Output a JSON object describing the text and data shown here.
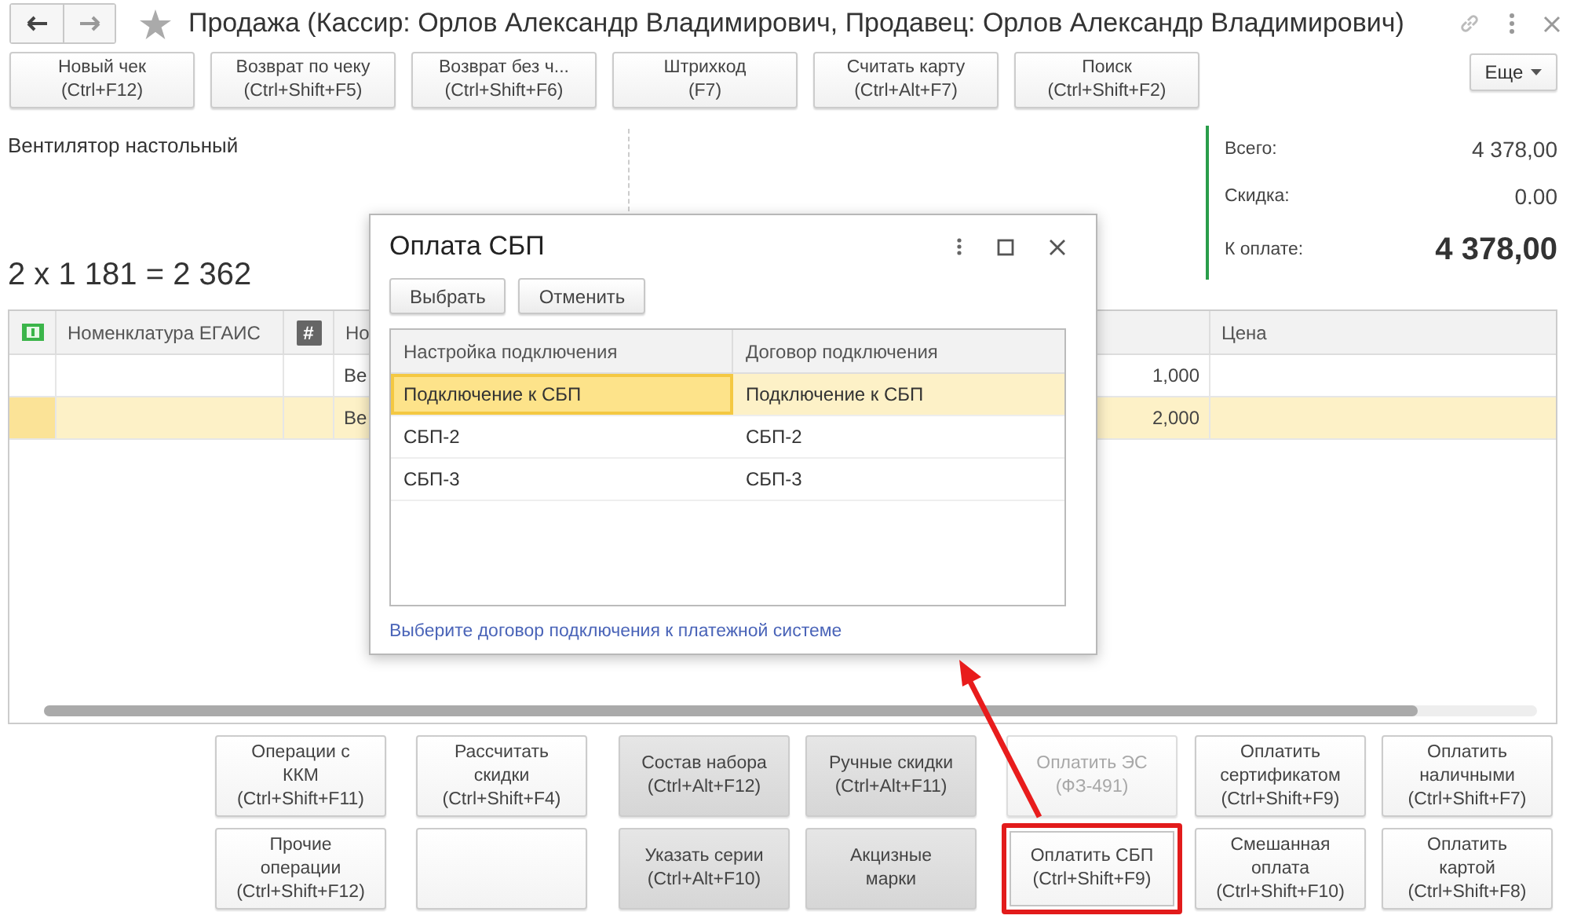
{
  "window": {
    "title": "Продажа (Кассир: Орлов Александр Владимирович, Продавец: Орлов Александр Владимирович)"
  },
  "toolbar": {
    "buttons": [
      {
        "label": "Новый чек\n(Ctrl+F12)"
      },
      {
        "label": "Возврат по чеку\n(Ctrl+Shift+F5)"
      },
      {
        "label": "Возврат без ч...\n(Ctrl+Shift+F6)"
      },
      {
        "label": "Штрихкод\n(F7)"
      },
      {
        "label": "Считать карту\n(Ctrl+Alt+F7)"
      },
      {
        "label": "Поиск\n(Ctrl+Shift+F2)"
      }
    ],
    "more": "Еще"
  },
  "product": {
    "name": "Вентилятор настольный",
    "calculation": "2 x 1 181 = 2 362"
  },
  "totals": [
    {
      "label": "Всего:",
      "value": "4 378,00",
      "kind": "normal"
    },
    {
      "label": "Скидка:",
      "value": "0.00",
      "kind": "normal"
    },
    {
      "label": "К оплате:",
      "value": "4 378,00",
      "kind": "big"
    }
  ],
  "table": {
    "columns": [
      {
        "kind": "icon"
      },
      {
        "kind": "text",
        "label": "Номенклатура ЕГАИС"
      },
      {
        "kind": "badge",
        "label": "#"
      },
      {
        "kind": "text",
        "label": "Но"
      },
      {
        "kind": "text"
      },
      {
        "kind": "text",
        "label": "Цена"
      }
    ],
    "rows": [
      {
        "name": "Ве",
        "quantity": "1,000",
        "selected": false
      },
      {
        "name": "Ве",
        "quantity": "2,000",
        "selected": true
      }
    ]
  },
  "dialog": {
    "title": "Оплата СБП",
    "buttons": [
      "Выбрать",
      "Отменить"
    ],
    "columns": [
      "Настройка подключения",
      "Договор подключения"
    ],
    "rows": [
      {
        "setting": "Подключение к СБП",
        "contract": "Подключение к СБП",
        "selected": true
      },
      {
        "setting": "СБП-2",
        "contract": "СБП-2",
        "selected": false
      },
      {
        "setting": "СБП-3",
        "contract": "СБП-3",
        "selected": false
      }
    ],
    "hint": "Выберите договор подключения к платежной системе"
  },
  "actions": [
    {
      "buttons": [
        {
          "label": "Операции с\nККМ\n(Ctrl+Shift+F11)",
          "kind": "plain",
          "disabled": false,
          "highlighted": false
        },
        {
          "label": "Рассчитать\nскидки\n(Ctrl+Shift+F4)",
          "kind": "plain",
          "disabled": false,
          "highlighted": false
        },
        {
          "label": "Состав набора\n(Ctrl+Alt+F12)",
          "kind": "shaded",
          "disabled": false,
          "highlighted": false
        },
        {
          "label": "Ручные скидки\n(Ctrl+Alt+F11)",
          "kind": "shaded",
          "disabled": false,
          "highlighted": false
        },
        {
          "label": "Оплатить ЭС\n(ФЗ-491)",
          "kind": "plain",
          "disabled": true,
          "highlighted": false
        },
        {
          "label": "Оплатить\nсертификатом\n(Ctrl+Shift+F9)",
          "kind": "plain",
          "disabled": false,
          "highlighted": false
        },
        {
          "label": "Оплатить\nналичными\n(Ctrl+Shift+F7)",
          "kind": "plain",
          "disabled": false,
          "highlighted": false
        }
      ]
    },
    {
      "buttons": [
        {
          "label": "Прочие\nоперации\n(Ctrl+Shift+F12)",
          "kind": "plain",
          "disabled": false,
          "highlighted": false
        },
        {
          "kind": "plain",
          "disabled": false,
          "highlighted": false
        },
        {
          "label": "Указать серии\n(Ctrl+Alt+F10)",
          "kind": "shaded",
          "disabled": false,
          "highlighted": false
        },
        {
          "label": "Акцизные\nмарки",
          "kind": "shaded",
          "disabled": false,
          "highlighted": false
        },
        {
          "label": "Оплатить СБП\n(Ctrl+Shift+F9)",
          "kind": "plain",
          "disabled": false,
          "highlighted": true
        },
        {
          "label": "Смешанная\nоплата\n(Ctrl+Shift+F10)",
          "kind": "plain",
          "disabled": false,
          "highlighted": false
        },
        {
          "label": "Оплатить\nкартой\n(Ctrl+Shift+F8)",
          "kind": "plain",
          "disabled": false,
          "highlighted": false
        }
      ]
    }
  ]
}
